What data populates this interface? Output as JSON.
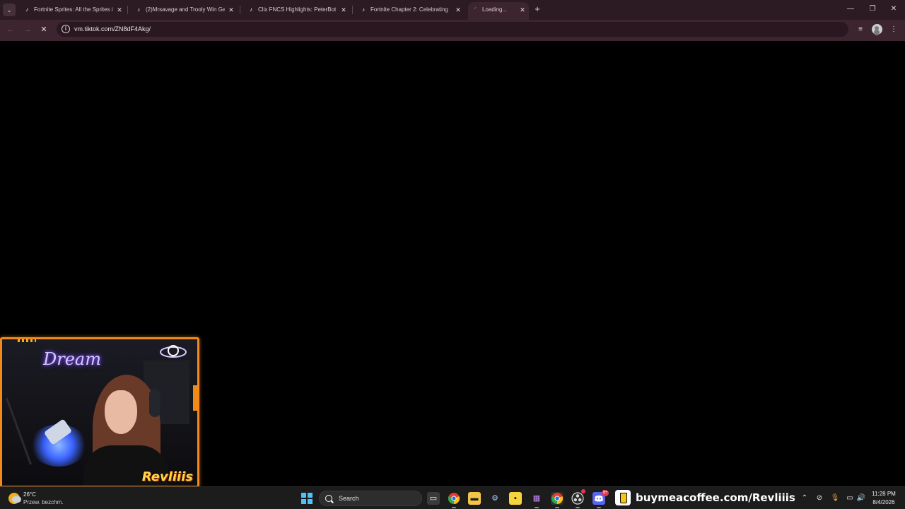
{
  "browser": {
    "tabs": [
      {
        "title": "Fortnite Sprites: All the Sprites i",
        "favicon": "tiktok-icon"
      },
      {
        "title": "(2)Mrsavage and Trooly Win Ga",
        "favicon": "tiktok-icon"
      },
      {
        "title": "Clix FNCS Highlights: PeterBot",
        "favicon": "tiktok-icon"
      },
      {
        "title": "Fortnite Chapter 2: Celebrating",
        "favicon": "tiktok-icon"
      },
      {
        "title": "Loading...",
        "favicon": "loading-spinner-icon",
        "active": true
      }
    ],
    "tab_close_glyph": "✕",
    "new_tab_glyph": "+",
    "address_bar": {
      "url": "vm.tiktok.com/ZN8dF4Akg/"
    },
    "nav": {
      "back": "←",
      "forward": "→",
      "stop": "✕"
    },
    "window_controls": {
      "minimize": "—",
      "restore": "❐",
      "close": "✕"
    },
    "toolbar_icons": [
      "reading-list-icon",
      "profile-avatar",
      "menu-icon"
    ]
  },
  "overlay": {
    "neon_sign": "Dream",
    "logo": "Revliiis"
  },
  "taskbar": {
    "weather": {
      "temp": "26°C",
      "condition": "Przew. bezchm."
    },
    "search": {
      "label": "Search"
    },
    "apps": [
      "task-view-icon",
      "chrome-icon",
      "file-explorer-icon",
      "settings-icon",
      "sticky-notes-icon",
      "app-icon",
      "chrome-icon",
      "obs-icon",
      "discord-icon"
    ],
    "discord_badge": "9+",
    "promo": "buymeacoffee.com/Revliiis",
    "clock": {
      "time": "11:28 PM",
      "date": "8/4/2026"
    }
  },
  "colors": {
    "tab_strip": "#2d1b24",
    "toolbar": "#3d2530",
    "overlay_border": "#f28a1a",
    "taskbar": "#1c1c1c"
  }
}
